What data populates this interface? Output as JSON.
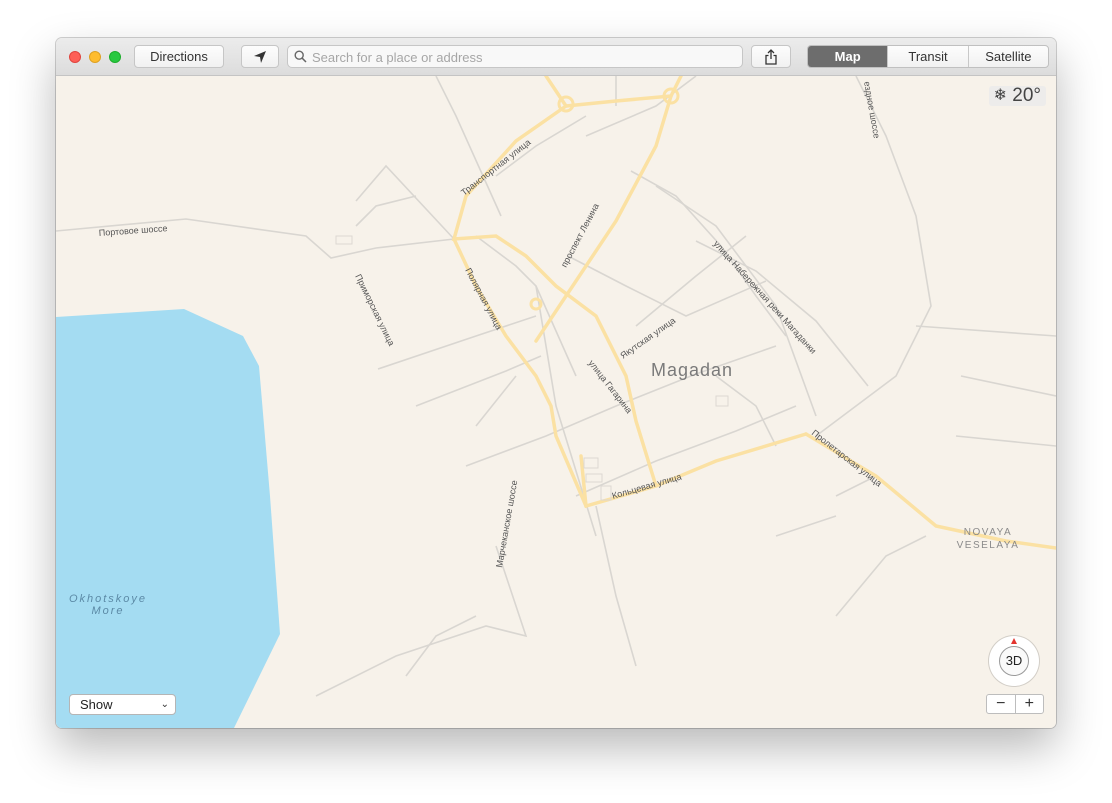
{
  "toolbar": {
    "directions_label": "Directions",
    "search_placeholder": "Search for a place or address",
    "map_modes": [
      "Map",
      "Transit",
      "Satellite"
    ],
    "active_mode": "Map"
  },
  "weather": {
    "icon": "snowflake-icon",
    "temperature": "20°"
  },
  "map": {
    "city_label": "Magadan",
    "district_label_line1": "NOVAYA",
    "district_label_line2": "VESELAYA",
    "water_label_line1": "Okhotskoye",
    "water_label_line2": "More",
    "streets": {
      "portovoe": "Портовое шоссе",
      "transportnaya": "Транспортная улица",
      "lenina": "проспект Ленина",
      "naberezhnaya": "улица Набережная реки Магаданки",
      "primorskaya": "Приморская улица",
      "polyarnaya": "Полярная улица",
      "yakutskaya": "Якутская улица",
      "gagarina": "улица Гагарина",
      "koltsevaya": "Кольцевая улица",
      "proletarskaya": "Пролетарская улица",
      "marchekanskoe": "Марчеканское шоссе",
      "ezdnoe": "ездное шоссе"
    },
    "colors": {
      "land": "#f7f2ea",
      "water": "#a4dcf2",
      "major_road": "#fbe1a3",
      "minor_road": "#d9d6d1",
      "label": "#555555"
    }
  },
  "controls": {
    "compass_label": "3D",
    "zoom_out": "−",
    "zoom_in": "+",
    "show_label": "Show"
  }
}
